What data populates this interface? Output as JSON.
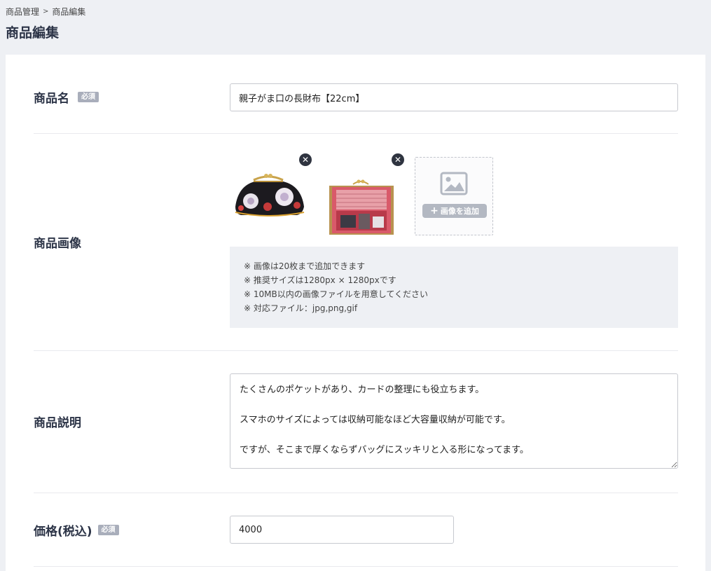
{
  "breadcrumb": {
    "parent": "商品管理",
    "separator": ">",
    "current": "商品編集"
  },
  "page_title": "商品編集",
  "form": {
    "name": {
      "label": "商品名",
      "required_badge": "必須",
      "value": "親子がま口の長財布【22cm】"
    },
    "images": {
      "label": "商品画像",
      "items": [
        {
          "alt": "black-floral-gamaguchi-wallet",
          "delete_icon": "close-icon"
        },
        {
          "alt": "open-red-gamaguchi-wallet",
          "delete_icon": "close-icon"
        }
      ],
      "add_label": "画像を追加",
      "notes": [
        "※ 画像は20枚まで追加できます",
        "※ 推奨サイズは1280px × 1280pxです",
        "※ 10MB以内の画像ファイルを用意してください",
        "※ 対応ファイル：jpg,png,gif"
      ]
    },
    "description": {
      "label": "商品説明",
      "value": "たくさんのポケットがあり、カードの整理にも役立ちます。\n\nスマホのサイズによっては収納可能なほど大容量収納が可能です。\n\nですが、そこまで厚くならずバッグにスッキリと入る形になってます。"
    },
    "price": {
      "label": "価格(税込)",
      "required_badge": "必須",
      "value": "4000"
    }
  },
  "colors": {
    "background": "#eef0f4",
    "title": "#2c3447",
    "badge": "#a9aebb",
    "delete_button": "#2f3440"
  }
}
